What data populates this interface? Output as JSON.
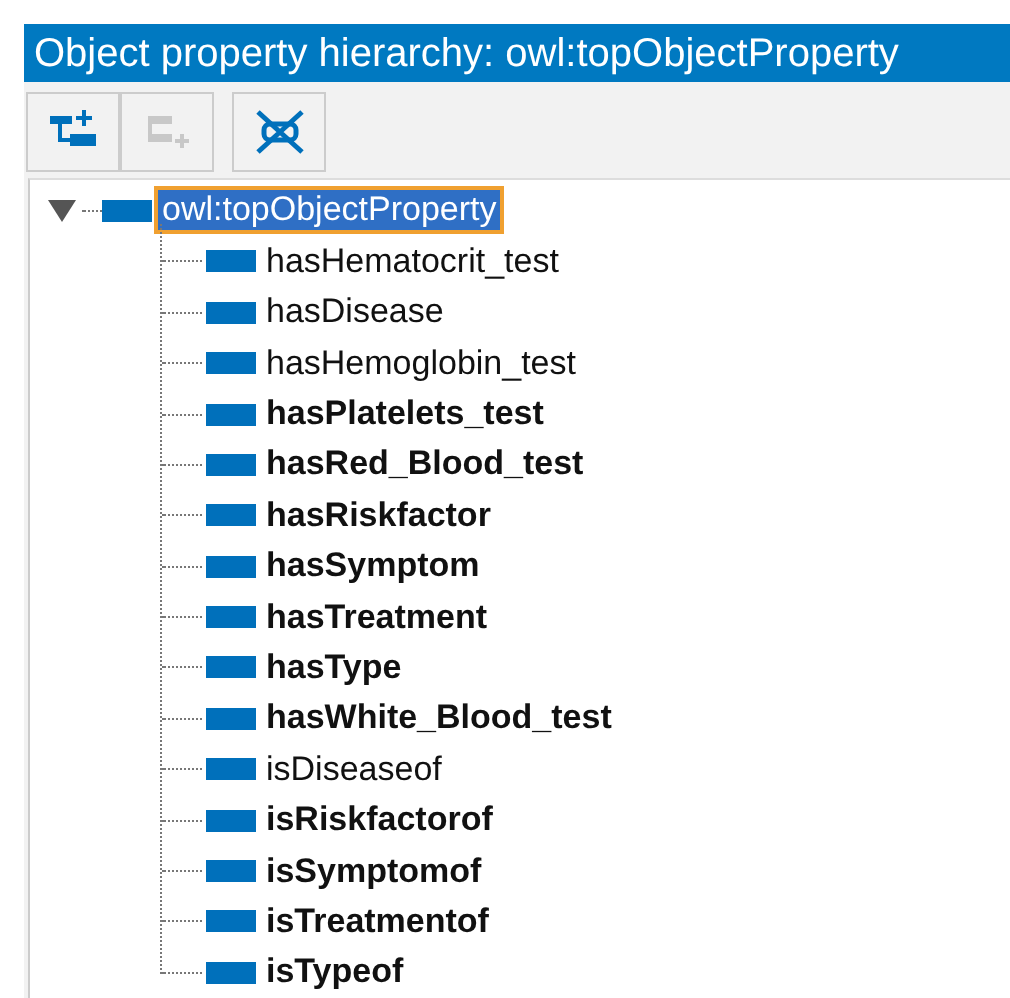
{
  "title": "Object property hierarchy: owl:topObjectProperty",
  "toolbar": [
    {
      "kind": "add-sub",
      "disabled": false
    },
    {
      "kind": "add-sibling",
      "disabled": true
    },
    {
      "kind": "delete",
      "disabled": false
    }
  ],
  "tree": {
    "label": "owl:topObjectProperty",
    "expanded": true,
    "selected": true,
    "bold": false,
    "children": [
      {
        "label": "hasHematocrit_test",
        "bold": false,
        "selected": false
      },
      {
        "label": "hasDisease",
        "bold": false,
        "selected": false
      },
      {
        "label": "hasHemoglobin_test",
        "bold": false,
        "selected": false
      },
      {
        "label": "hasPlatelets_test",
        "bold": true,
        "selected": false
      },
      {
        "label": "hasRed_Blood_test",
        "bold": true,
        "selected": false
      },
      {
        "label": "hasRiskfactor",
        "bold": true,
        "selected": false
      },
      {
        "label": "hasSymptom",
        "bold": true,
        "selected": false
      },
      {
        "label": "hasTreatment",
        "bold": true,
        "selected": false
      },
      {
        "label": "hasType",
        "bold": true,
        "selected": false
      },
      {
        "label": "hasWhite_Blood_test",
        "bold": true,
        "selected": false
      },
      {
        "label": "isDiseaseof",
        "bold": false,
        "selected": false
      },
      {
        "label": "isRiskfactorof",
        "bold": true,
        "selected": false
      },
      {
        "label": "isSymptomof",
        "bold": true,
        "selected": false
      },
      {
        "label": "isTreatmentof",
        "bold": true,
        "selected": false
      },
      {
        "label": "isTypeof",
        "bold": true,
        "selected": false
      }
    ]
  }
}
